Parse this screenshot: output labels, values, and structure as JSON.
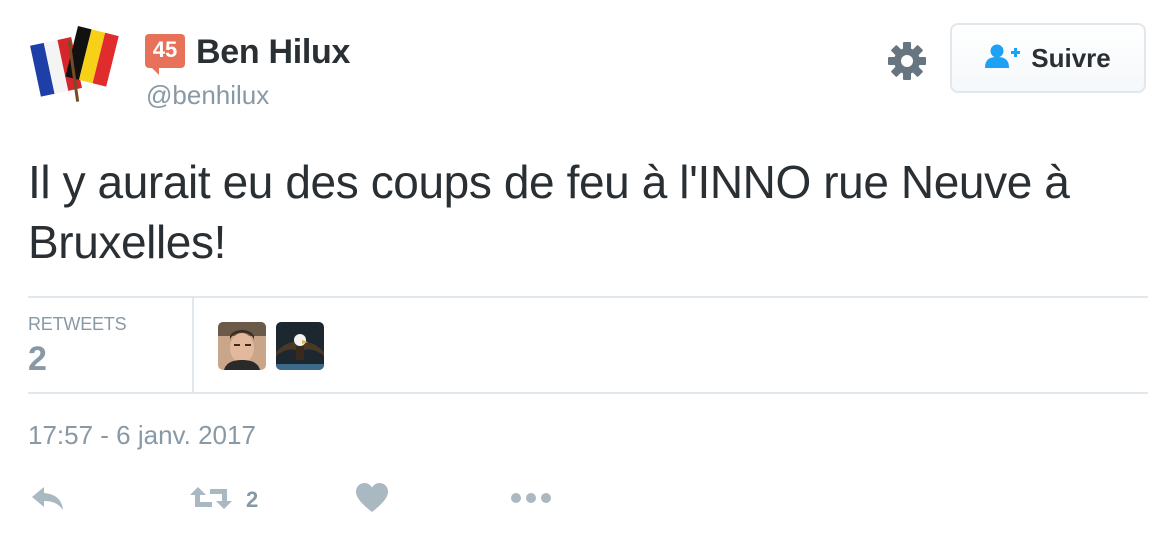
{
  "user": {
    "badge": "45",
    "display_name": "Ben Hilux",
    "username": "@benhilux"
  },
  "follow_button": {
    "label": "Suivre"
  },
  "tweet": {
    "text": "Il y aurait eu des coups de feu à l'INNO rue Neuve à Bruxelles!",
    "timestamp": "17:57 - 6 janv. 2017"
  },
  "stats": {
    "retweets_label": "RETWEETS",
    "retweets_value": "2"
  },
  "actions": {
    "retweet_count": "2"
  },
  "icons": [
    "gear-icon",
    "add-user-icon",
    "reply-icon",
    "retweet-icon",
    "heart-icon",
    "more-icon"
  ],
  "colors": {
    "text": "#292f33",
    "muted": "#8899a6",
    "accent": "#1da1f2",
    "badge": "#e8715a",
    "divider": "#e1e8ed"
  }
}
